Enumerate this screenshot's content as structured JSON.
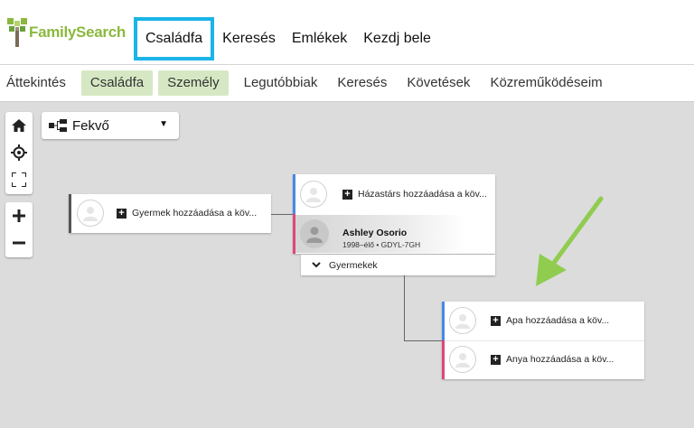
{
  "header": {
    "logo_text": "FamilySearch",
    "nav": [
      {
        "label": "Családfa",
        "active": true
      },
      {
        "label": "Keresés"
      },
      {
        "label": "Emlékek"
      },
      {
        "label": "Kezdj bele"
      }
    ]
  },
  "subnav": {
    "tabs": [
      {
        "label": "Áttekintés"
      },
      {
        "label": "Családfa"
      },
      {
        "label": "Személy"
      },
      {
        "label": "Legutóbbiak"
      },
      {
        "label": "Keresés"
      },
      {
        "label": "Követések"
      },
      {
        "label": "Közreműködéseim"
      }
    ]
  },
  "tree": {
    "layout_select": {
      "label": "Fekvő"
    },
    "child_card": {
      "add_label": "Gyermek hozzáadása a köv..."
    },
    "couple_card": {
      "spouse_add_label": "Házastárs hozzáadása a köv...",
      "person": {
        "name": "Ashley Osorio",
        "meta": "1998–élő • GDYL-7GH"
      },
      "children_label": "Gyermekek"
    },
    "parents_card": {
      "father_add_label": "Apa hozzáadása a köv...",
      "mother_add_label": "Anya hozzáadása a köv..."
    }
  },
  "colors": {
    "brand_green": "#8cb83f",
    "highlight_box": "#1ab4e8",
    "male_bar": "#4a86e8",
    "female_bar": "#e0457b",
    "arrow": "#8fcc4f"
  },
  "icons": [
    "home-icon",
    "recenter-icon",
    "fullscreen-icon",
    "zoom-in-icon",
    "zoom-out-icon",
    "layout-tree-icon",
    "chevron-down-icon",
    "plus-box-icon",
    "avatar-placeholder-icon"
  ]
}
